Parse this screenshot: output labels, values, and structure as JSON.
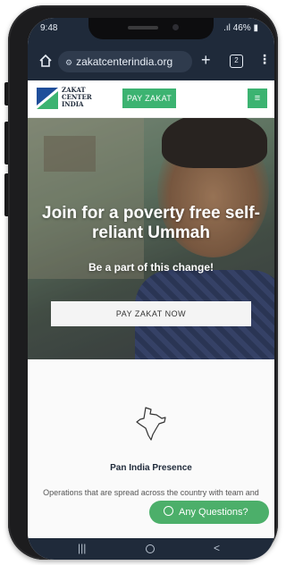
{
  "status_bar": {
    "time": "9:48",
    "signal": ".ıl",
    "battery": "46%"
  },
  "browser": {
    "url": "zakatcenterindia.org",
    "tab_count": "2",
    "new_tab": "+"
  },
  "site": {
    "logo_text": [
      "ZAKAT",
      "CENTER",
      "INDIA"
    ],
    "pay_zakat_label": "PAY ZAKAT",
    "menu_icon": "menu-icon"
  },
  "hero": {
    "title": "Join for a poverty free self-reliant Ummah",
    "subtitle": "Be a part of this change!",
    "cta_label": "PAY ZAKAT NOW"
  },
  "feature": {
    "icon": "india-map-icon",
    "title": "Pan India Presence",
    "description": "Operations that are spread across the country with team and"
  },
  "chat_button": {
    "label": "Any Questions?",
    "icon": "whatsapp-icon"
  },
  "nav": {
    "recents": "|||",
    "back": "<"
  },
  "colors": {
    "accent_green": "#3cb371",
    "dark_bar": "#1f2a3a"
  }
}
